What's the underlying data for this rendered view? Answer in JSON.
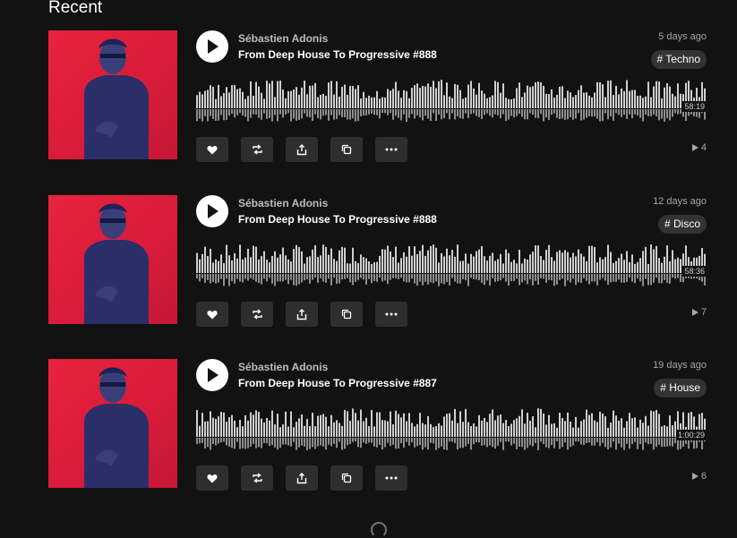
{
  "section": {
    "title": "Recent"
  },
  "tracks": [
    {
      "artist": "Sébastien Adonis",
      "title": "From Deep House To Progressive #888",
      "date": "5 days ago",
      "tag": "# Techno",
      "duration": "58:19",
      "plays": "4",
      "waveform_seed": 3
    },
    {
      "artist": "Sébastien Adonis",
      "title": "From Deep House To Progressive #888",
      "date": "12 days ago",
      "tag": "# Disco",
      "duration": "58:36",
      "plays": "7",
      "waveform_seed": 7
    },
    {
      "artist": "Sébastien Adonis",
      "title": "From Deep House To Progressive #887",
      "date": "19 days ago",
      "tag": "# House",
      "duration": "1:00:29",
      "plays": "6",
      "waveform_seed": 11
    }
  ],
  "icons": {
    "play": "play-icon",
    "like": "heart-icon",
    "repost": "repost-icon",
    "share": "share-icon",
    "copy": "copy-icon",
    "more": "more-icon",
    "plays": "play-count-icon"
  },
  "colors": {
    "background": "#121212",
    "cover": "#e0203a",
    "button": "#2e2e2e",
    "waveform": "#cfcfcf",
    "tag_bg": "#333333"
  }
}
